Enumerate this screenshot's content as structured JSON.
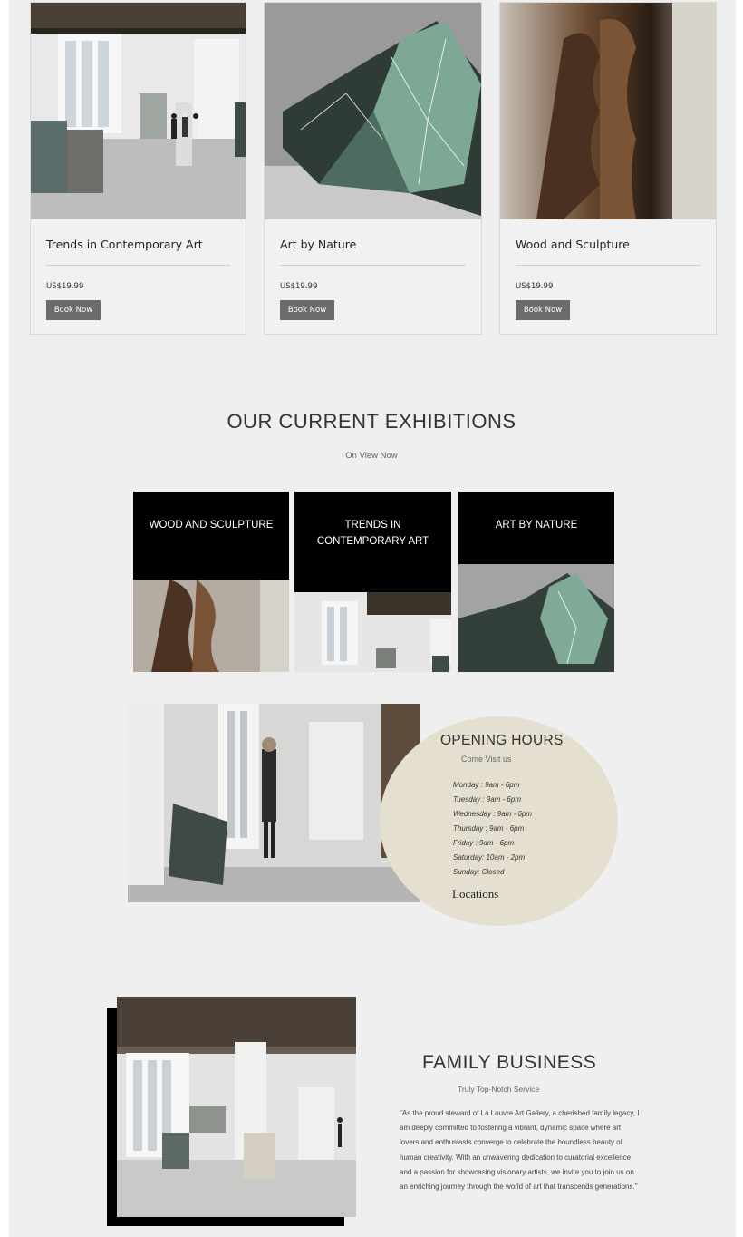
{
  "cards": [
    {
      "title": "Trends in Contemporary Art",
      "price": "US$19.99",
      "button": "Book Now"
    },
    {
      "title": "Art by Nature",
      "price": "US$19.99",
      "button": "Book Now"
    },
    {
      "title": "Wood and Sculpture",
      "price": "US$19.99",
      "button": "Book Now"
    }
  ],
  "exhibitions": {
    "title": "OUR CURRENT EXHIBITIONS",
    "subtitle": "On View Now",
    "tiles": [
      {
        "label": "WOOD AND SCULPTURE"
      },
      {
        "label": "TRENDS IN CONTEMPORARY ART"
      },
      {
        "label": "ART BY NATURE"
      }
    ]
  },
  "opening_hours": {
    "title": "OPENING HOURS",
    "subtitle": "Come Visit us",
    "days": [
      "Monday : 9am - 6pm",
      "Tuesday : 9am - 6pm",
      "Wednesday : 9am - 6pm",
      "Thursday : 9am - 6pm",
      "Friday : 9am - 6pm",
      "Saturday: 10am - 2pm",
      "Sunday: Closed"
    ],
    "locations_link": "Locations"
  },
  "family_business": {
    "title": "FAMILY BUSINESS",
    "subtitle": "Truly Top-Notch Service",
    "quote": "\"As the proud steward of La Louvre Art Gallery, a cherished family legacy, I am deeply committed to fostering a vibrant, dynamic space where art lovers and enthusiasts converge to celebrate the boundless beauty of human creativity. With an unwavering dedication to curatorial excellence and a passion for showcasing visionary artists, we invite you to join us on an enriching journey through the world of art that transcends generations.\""
  }
}
